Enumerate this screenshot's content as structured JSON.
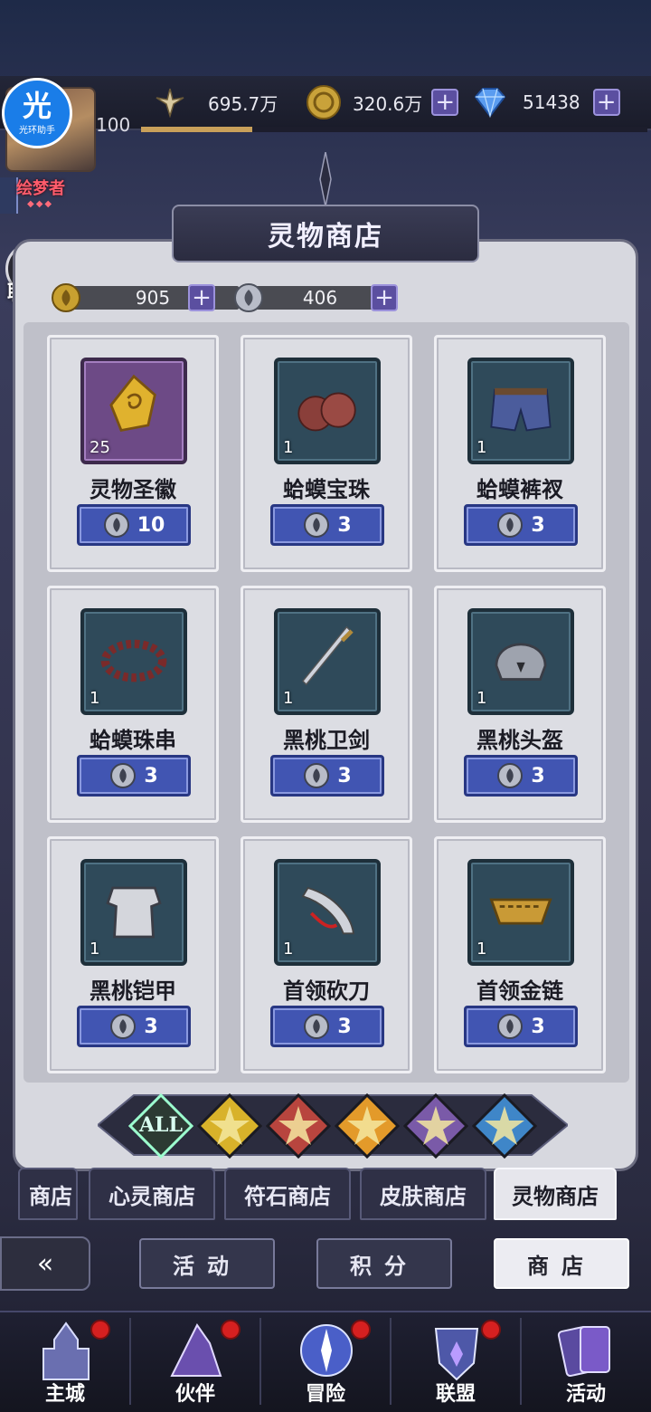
{
  "top_bar": {
    "power": "695.7万",
    "gold": "320.6万",
    "diamond": "51438",
    "level": "100",
    "helper_glyph": "光",
    "helper_name": "光环助手",
    "title_badge": "绘梦者",
    "chat_label": "聊 天"
  },
  "shop": {
    "title": "灵物商店",
    "currencies": [
      {
        "icon": "gold-spirit-coin-icon",
        "value": "905"
      },
      {
        "icon": "silver-spirit-coin-icon",
        "value": "406"
      }
    ],
    "items": [
      {
        "name": "灵物圣徽",
        "qty": "25",
        "price": "10",
        "icon": "gold-emblem-icon",
        "frame": "purple"
      },
      {
        "name": "蛤蟆宝珠",
        "qty": "1",
        "price": "3",
        "icon": "twin-orbs-icon",
        "frame": "teal"
      },
      {
        "name": "蛤蟆裤衩",
        "qty": "1",
        "price": "3",
        "icon": "shorts-icon",
        "frame": "teal"
      },
      {
        "name": "蛤蟆珠串",
        "qty": "1",
        "price": "3",
        "icon": "bead-necklace-icon",
        "frame": "teal"
      },
      {
        "name": "黑桃卫剑",
        "qty": "1",
        "price": "3",
        "icon": "sword-icon",
        "frame": "teal"
      },
      {
        "name": "黑桃头盔",
        "qty": "1",
        "price": "3",
        "icon": "helmet-icon",
        "frame": "teal"
      },
      {
        "name": "黑桃铠甲",
        "qty": "1",
        "price": "3",
        "icon": "armor-icon",
        "frame": "teal"
      },
      {
        "name": "首领砍刀",
        "qty": "1",
        "price": "3",
        "icon": "machete-icon",
        "frame": "teal"
      },
      {
        "name": "首领金链",
        "qty": "1",
        "price": "3",
        "icon": "gold-chain-icon",
        "frame": "teal"
      }
    ],
    "filters": [
      {
        "label": "ALL",
        "color": "#2c3a33"
      },
      {
        "label": "",
        "color": "#d8b22a"
      },
      {
        "label": "",
        "color": "#b8453e"
      },
      {
        "label": "",
        "color": "#e39a2a"
      },
      {
        "label": "",
        "color": "#7a5aa8"
      },
      {
        "label": "",
        "color": "#3f86c8"
      }
    ]
  },
  "sub_tabs": [
    "商店",
    "心灵商店",
    "符石商店",
    "皮肤商店",
    "灵物商店"
  ],
  "mode_tabs": [
    "活动",
    "积分",
    "商店"
  ],
  "bottom_nav": [
    {
      "label": "主城",
      "icon": "castle-icon"
    },
    {
      "label": "伙伴",
      "icon": "wizard-hat-icon"
    },
    {
      "label": "冒险",
      "icon": "compass-orb-icon"
    },
    {
      "label": "联盟",
      "icon": "shield-crest-icon"
    },
    {
      "label": "活动",
      "icon": "cards-icon"
    }
  ]
}
